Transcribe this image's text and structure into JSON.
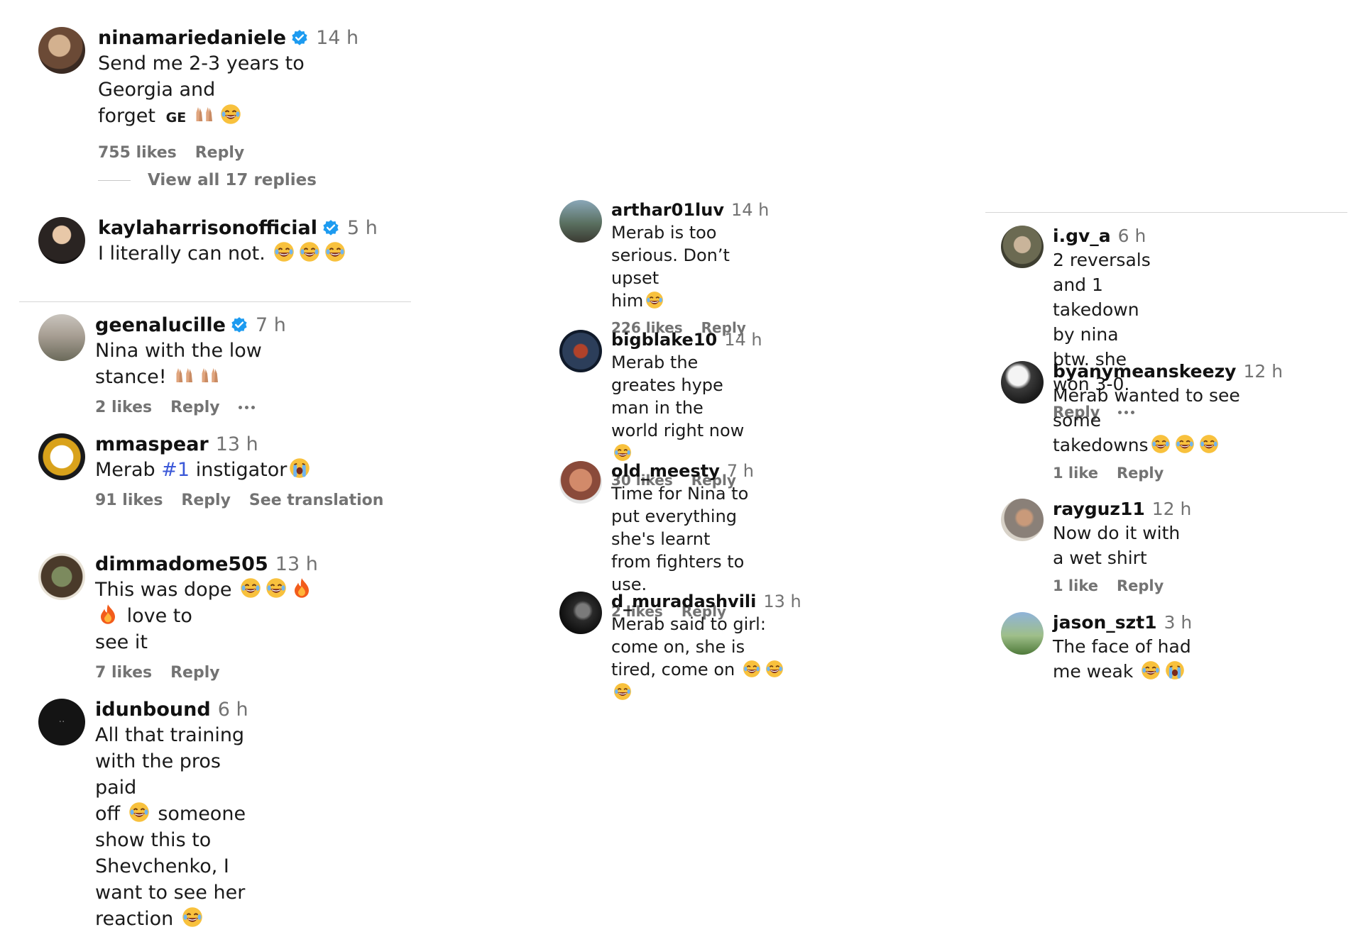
{
  "col1": {
    "c1": {
      "user": "ninamariedaniele",
      "time": "14 h",
      "text1": "Send me 2-3 years to Georgia and",
      "text2": "forget",
      "ge": "GE",
      "likes": "755 likes",
      "reply": "Reply"
    },
    "view_replies": "View all 17 replies",
    "c2": {
      "user": "kaylaharrisonofficial",
      "time": "5 h",
      "text": "I literally can not."
    },
    "c3": {
      "user": "geenalucille",
      "time": "7 h",
      "text": "Nina with the low stance!",
      "likes": "2 likes",
      "reply": "Reply"
    },
    "c4": {
      "user": "mmaspear",
      "time": "13 h",
      "text_a": "Merab",
      "hashtag": "#1",
      "text_b": "instigator",
      "likes": "91 likes",
      "reply": "Reply",
      "translate": "See translation"
    },
    "c5": {
      "user": "dimmadome505",
      "time": "13 h",
      "text1a": "This was dope",
      "text1b": "love to",
      "text2": "see it",
      "likes": "7 likes",
      "reply": "Reply"
    },
    "c6": {
      "user": "idunbound",
      "time": "6 h",
      "text1": "All that training with the pros paid",
      "text2a": "off",
      "text2b": "someone show this to",
      "text3": "Shevchenko, I want to see her",
      "text4": "reaction"
    }
  },
  "col2": {
    "c1": {
      "user": "arthar01luv",
      "time": "14 h",
      "text1": "Merab is too serious. Don’t upset",
      "text2": "him",
      "likes": "226 likes",
      "reply": "Reply"
    },
    "c2": {
      "user": "bigblake10",
      "time": "14 h",
      "text1": "Merab the greates hype man in the",
      "text2": "world right now",
      "likes": "30 likes",
      "reply": "Reply"
    },
    "c3": {
      "user": "old_meesty",
      "time": "7 h",
      "text1": "Time for Nina to put everything",
      "text2": "she's learnt from fighters to use.",
      "likes": "2 likes",
      "reply": "Reply"
    },
    "c4": {
      "user": "d_muradashvili",
      "time": "13 h",
      "text1": "Merab said to girl: come on, she is",
      "text2": "tired, come on"
    }
  },
  "col3": {
    "c1": {
      "user": "i.gv_a",
      "time": "6 h",
      "text1": "2 reversals and 1 takedown by nina",
      "text2": "btw. she won 3-0.",
      "reply": "Reply"
    },
    "c2": {
      "user": "byanymeanskeezy",
      "time": "12 h",
      "text1": "Merab wanted to see some",
      "text2": "takedowns",
      "likes": "1 like",
      "reply": "Reply"
    },
    "c3": {
      "user": "rayguz11",
      "time": "12 h",
      "text": "Now do it with a wet shirt",
      "likes": "1 like",
      "reply": "Reply"
    },
    "c4": {
      "user": "jason_szt1",
      "time": "3 h",
      "text": "The face of had me weak"
    }
  },
  "icons": {
    "verified": "verified-badge-icon",
    "laugh": "face-with-tears-of-joy-emoji",
    "hands": "raising-hands-emoji",
    "fire": "fire-emoji",
    "cry": "loudly-crying-face-emoji",
    "more": "more-options-icon"
  },
  "colors": {
    "accent": "#1d9bf0",
    "link": "#3b58d8",
    "muted": "#737373"
  }
}
